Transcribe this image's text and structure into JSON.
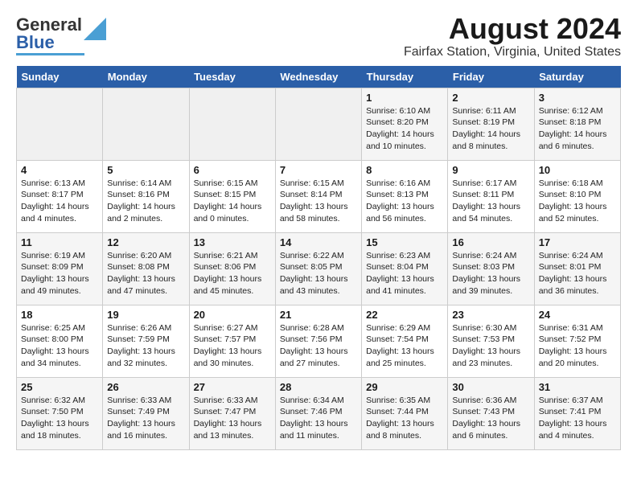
{
  "header": {
    "logo_general": "General",
    "logo_blue": "Blue",
    "month_title": "August 2024",
    "location": "Fairfax Station, Virginia, United States"
  },
  "days_of_week": [
    "Sunday",
    "Monday",
    "Tuesday",
    "Wednesday",
    "Thursday",
    "Friday",
    "Saturday"
  ],
  "weeks": [
    [
      {
        "day": "",
        "info": ""
      },
      {
        "day": "",
        "info": ""
      },
      {
        "day": "",
        "info": ""
      },
      {
        "day": "",
        "info": ""
      },
      {
        "day": "1",
        "info": "Sunrise: 6:10 AM\nSunset: 8:20 PM\nDaylight: 14 hours\nand 10 minutes."
      },
      {
        "day": "2",
        "info": "Sunrise: 6:11 AM\nSunset: 8:19 PM\nDaylight: 14 hours\nand 8 minutes."
      },
      {
        "day": "3",
        "info": "Sunrise: 6:12 AM\nSunset: 8:18 PM\nDaylight: 14 hours\nand 6 minutes."
      }
    ],
    [
      {
        "day": "4",
        "info": "Sunrise: 6:13 AM\nSunset: 8:17 PM\nDaylight: 14 hours\nand 4 minutes."
      },
      {
        "day": "5",
        "info": "Sunrise: 6:14 AM\nSunset: 8:16 PM\nDaylight: 14 hours\nand 2 minutes."
      },
      {
        "day": "6",
        "info": "Sunrise: 6:15 AM\nSunset: 8:15 PM\nDaylight: 14 hours\nand 0 minutes."
      },
      {
        "day": "7",
        "info": "Sunrise: 6:15 AM\nSunset: 8:14 PM\nDaylight: 13 hours\nand 58 minutes."
      },
      {
        "day": "8",
        "info": "Sunrise: 6:16 AM\nSunset: 8:13 PM\nDaylight: 13 hours\nand 56 minutes."
      },
      {
        "day": "9",
        "info": "Sunrise: 6:17 AM\nSunset: 8:11 PM\nDaylight: 13 hours\nand 54 minutes."
      },
      {
        "day": "10",
        "info": "Sunrise: 6:18 AM\nSunset: 8:10 PM\nDaylight: 13 hours\nand 52 minutes."
      }
    ],
    [
      {
        "day": "11",
        "info": "Sunrise: 6:19 AM\nSunset: 8:09 PM\nDaylight: 13 hours\nand 49 minutes."
      },
      {
        "day": "12",
        "info": "Sunrise: 6:20 AM\nSunset: 8:08 PM\nDaylight: 13 hours\nand 47 minutes."
      },
      {
        "day": "13",
        "info": "Sunrise: 6:21 AM\nSunset: 8:06 PM\nDaylight: 13 hours\nand 45 minutes."
      },
      {
        "day": "14",
        "info": "Sunrise: 6:22 AM\nSunset: 8:05 PM\nDaylight: 13 hours\nand 43 minutes."
      },
      {
        "day": "15",
        "info": "Sunrise: 6:23 AM\nSunset: 8:04 PM\nDaylight: 13 hours\nand 41 minutes."
      },
      {
        "day": "16",
        "info": "Sunrise: 6:24 AM\nSunset: 8:03 PM\nDaylight: 13 hours\nand 39 minutes."
      },
      {
        "day": "17",
        "info": "Sunrise: 6:24 AM\nSunset: 8:01 PM\nDaylight: 13 hours\nand 36 minutes."
      }
    ],
    [
      {
        "day": "18",
        "info": "Sunrise: 6:25 AM\nSunset: 8:00 PM\nDaylight: 13 hours\nand 34 minutes."
      },
      {
        "day": "19",
        "info": "Sunrise: 6:26 AM\nSunset: 7:59 PM\nDaylight: 13 hours\nand 32 minutes."
      },
      {
        "day": "20",
        "info": "Sunrise: 6:27 AM\nSunset: 7:57 PM\nDaylight: 13 hours\nand 30 minutes."
      },
      {
        "day": "21",
        "info": "Sunrise: 6:28 AM\nSunset: 7:56 PM\nDaylight: 13 hours\nand 27 minutes."
      },
      {
        "day": "22",
        "info": "Sunrise: 6:29 AM\nSunset: 7:54 PM\nDaylight: 13 hours\nand 25 minutes."
      },
      {
        "day": "23",
        "info": "Sunrise: 6:30 AM\nSunset: 7:53 PM\nDaylight: 13 hours\nand 23 minutes."
      },
      {
        "day": "24",
        "info": "Sunrise: 6:31 AM\nSunset: 7:52 PM\nDaylight: 13 hours\nand 20 minutes."
      }
    ],
    [
      {
        "day": "25",
        "info": "Sunrise: 6:32 AM\nSunset: 7:50 PM\nDaylight: 13 hours\nand 18 minutes."
      },
      {
        "day": "26",
        "info": "Sunrise: 6:33 AM\nSunset: 7:49 PM\nDaylight: 13 hours\nand 16 minutes."
      },
      {
        "day": "27",
        "info": "Sunrise: 6:33 AM\nSunset: 7:47 PM\nDaylight: 13 hours\nand 13 minutes."
      },
      {
        "day": "28",
        "info": "Sunrise: 6:34 AM\nSunset: 7:46 PM\nDaylight: 13 hours\nand 11 minutes."
      },
      {
        "day": "29",
        "info": "Sunrise: 6:35 AM\nSunset: 7:44 PM\nDaylight: 13 hours\nand 8 minutes."
      },
      {
        "day": "30",
        "info": "Sunrise: 6:36 AM\nSunset: 7:43 PM\nDaylight: 13 hours\nand 6 minutes."
      },
      {
        "day": "31",
        "info": "Sunrise: 6:37 AM\nSunset: 7:41 PM\nDaylight: 13 hours\nand 4 minutes."
      }
    ]
  ]
}
